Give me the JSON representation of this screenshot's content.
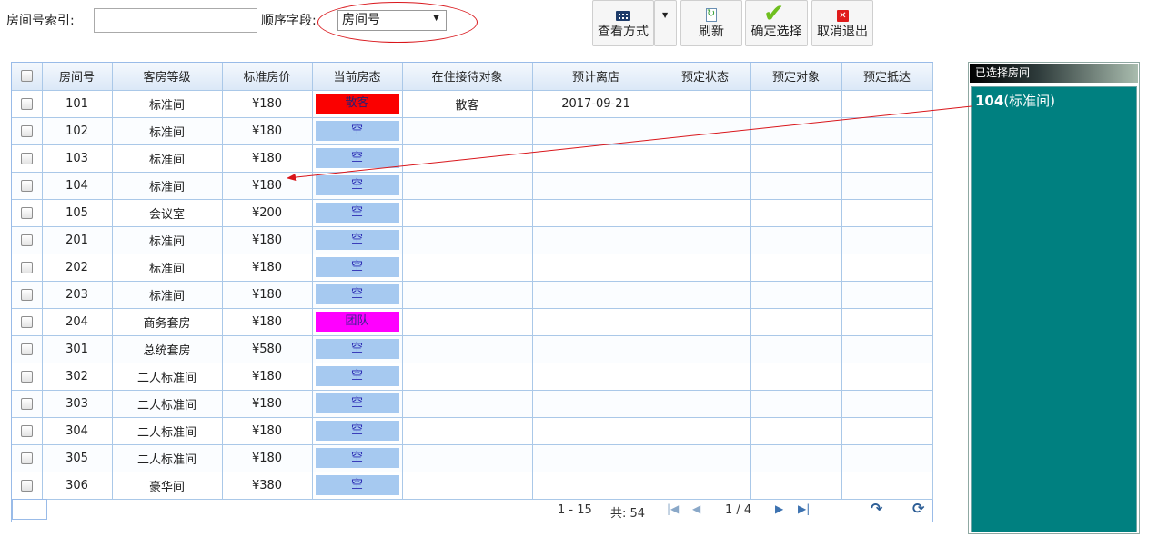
{
  "toolbar": {
    "search_label": "房间号索引:",
    "search_value": "",
    "sort_label": "顺序字段:",
    "sort_selected": "房间号",
    "view_label": "查看方式",
    "refresh_label": "刷新",
    "confirm_label": "确定选择",
    "cancel_label": "取消退出"
  },
  "grid": {
    "columns": [
      "房间号",
      "客房等级",
      "标准房价",
      "当前房态",
      "在住接待对象",
      "预计离店",
      "预定状态",
      "预定对象",
      "预定抵达"
    ],
    "rows": [
      {
        "room": "101",
        "type": "标准间",
        "price": "¥180",
        "status": "散客",
        "guest": "散客",
        "checkout": "2017-09-21",
        "res_status": "",
        "res_target": "",
        "res_arrive": ""
      },
      {
        "room": "102",
        "type": "标准间",
        "price": "¥180",
        "status": "空",
        "guest": "",
        "checkout": "",
        "res_status": "",
        "res_target": "",
        "res_arrive": ""
      },
      {
        "room": "103",
        "type": "标准间",
        "price": "¥180",
        "status": "空",
        "guest": "",
        "checkout": "",
        "res_status": "",
        "res_target": "",
        "res_arrive": ""
      },
      {
        "room": "104",
        "type": "标准间",
        "price": "¥180",
        "status": "空",
        "guest": "",
        "checkout": "",
        "res_status": "",
        "res_target": "",
        "res_arrive": ""
      },
      {
        "room": "105",
        "type": "会议室",
        "price": "¥200",
        "status": "空",
        "guest": "",
        "checkout": "",
        "res_status": "",
        "res_target": "",
        "res_arrive": ""
      },
      {
        "room": "201",
        "type": "标准间",
        "price": "¥180",
        "status": "空",
        "guest": "",
        "checkout": "",
        "res_status": "",
        "res_target": "",
        "res_arrive": ""
      },
      {
        "room": "202",
        "type": "标准间",
        "price": "¥180",
        "status": "空",
        "guest": "",
        "checkout": "",
        "res_status": "",
        "res_target": "",
        "res_arrive": ""
      },
      {
        "room": "203",
        "type": "标准间",
        "price": "¥180",
        "status": "空",
        "guest": "",
        "checkout": "",
        "res_status": "",
        "res_target": "",
        "res_arrive": ""
      },
      {
        "room": "204",
        "type": "商务套房",
        "price": "¥180",
        "status": "团队",
        "guest": "",
        "checkout": "",
        "res_status": "",
        "res_target": "",
        "res_arrive": ""
      },
      {
        "room": "301",
        "type": "总统套房",
        "price": "¥580",
        "status": "空",
        "guest": "",
        "checkout": "",
        "res_status": "",
        "res_target": "",
        "res_arrive": ""
      },
      {
        "room": "302",
        "type": "二人标准间",
        "price": "¥180",
        "status": "空",
        "guest": "",
        "checkout": "",
        "res_status": "",
        "res_target": "",
        "res_arrive": ""
      },
      {
        "room": "303",
        "type": "二人标准间",
        "price": "¥180",
        "status": "空",
        "guest": "",
        "checkout": "",
        "res_status": "",
        "res_target": "",
        "res_arrive": ""
      },
      {
        "room": "304",
        "type": "二人标准间",
        "price": "¥180",
        "status": "空",
        "guest": "",
        "checkout": "",
        "res_status": "",
        "res_target": "",
        "res_arrive": ""
      },
      {
        "room": "305",
        "type": "二人标准间",
        "price": "¥180",
        "status": "空",
        "guest": "",
        "checkout": "",
        "res_status": "",
        "res_target": "",
        "res_arrive": ""
      },
      {
        "room": "306",
        "type": "豪华间",
        "price": "¥380",
        "status": "空",
        "guest": "",
        "checkout": "",
        "res_status": "",
        "res_target": "",
        "res_arrive": ""
      }
    ],
    "status_colors": {
      "散客": "#fb0000",
      "空": "#a6c9f0",
      "团队": "#ff00ff"
    }
  },
  "pager": {
    "range": "1 - 15",
    "total": "共: 54",
    "page": "1 / 4",
    "page_input": ""
  },
  "selected": {
    "header": "已选择房间",
    "room_number": "104",
    "room_type": "(标准间)"
  },
  "colors": {
    "panel_bg": "#008080",
    "annotation": "#d9161b",
    "grid_border": "#99bbe8"
  }
}
